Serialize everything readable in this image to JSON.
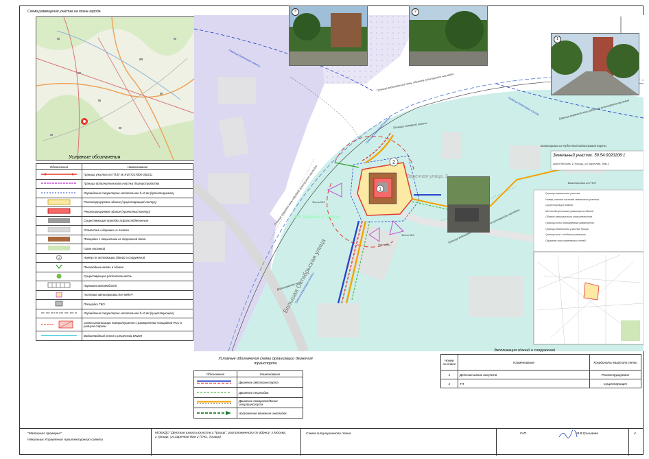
{
  "location_map": {
    "caption": "Схема размещения участка на плане города"
  },
  "legend": {
    "title": "Условные обозначения",
    "header_symbol": "Обозначения",
    "header_name": "Наименование",
    "items": [
      "Граница участка по ГПЗУ № RU77227000-030211",
      "Граница дополнительного участка благоустройства",
      "Ограждение территории капитальное h=2,4м (проектируемое)",
      "Реконструируемое здание (существующий контур)",
      "Реконструируемое здание (проектный контур)",
      "Существующие проезды асфальтобетонные",
      "Отмостка и дорожки из плитки",
      "Площадка с покрытием из террасной доски",
      "Газон посевной",
      "Номер по экспликации зданий и сооружений",
      "Пешеходные входы в здание",
      "Существующая растительность",
      "Парковка автомобилей",
      "Гостевая автопарковка для ММГН",
      "Площадка ТБО",
      "Ограждение территории капитальное h=2,4м (существующее)",
      "Схема организации пожаротушения с разворотной площадкой РСС в радиусе стрелы",
      "Водоотводный лоток с решеткой DN200"
    ]
  },
  "plan": {
    "north_symbol": "С",
    "labels": {
      "border_1": "Граница Береговой полосы",
      "border_2": "Граница Береговой полосы",
      "border_3": "Граница Береговой полосы",
      "border_4": "Граница Береговой полосы",
      "water_zone_1": "Граница водоохранной зоны объекта культурного наследия",
      "water_zone_2": "Граница охранной зоны объекта культурного наследия",
      "water_zone_3": "Граница охранной зоны объекта культурного наследия",
      "water_zone_4": "Граница водоохранной зоны объекта культурного наследия",
      "water_zone_5": "Водоохранная зона",
      "fire_border": "Граница пожарной охраны",
      "map_source": "Выкопировка из Публичной кадастровой Карты",
      "gpzu_excerpt": "Выкопировка из ГПЗУ",
      "cadastre": "Земельный участок: 50:54:0020206:1",
      "cadastre_address": "город Москва, г.Троицк, ул.Заречная, дом 2",
      "street_big": "Большая Октябрьская улица",
      "street_2": "Заречная улица, 2",
      "school": "ЗСК Заречная в Троицке",
      "photo_label_1": "Фото №1",
      "photo_label_2": "Фото №2",
      "photo_label_3": "Фото №3",
      "marker_1": "1",
      "marker_2": "2"
    },
    "excerpt_legend": [
      "Границы земельного участка",
      "Номер участка на плане земельного участка",
      "Существующие здания",
      "Места допустимого размещения зданий",
      "Объект капитального строительства",
      "Границы зоны планируемого размещения",
      "Границы земельного участка Троицк",
      "Границы зон с особыми условиями",
      "Охранная зона инженерных сетей"
    ]
  },
  "photos": [
    {
      "number": "3"
    },
    {
      "number": "2"
    },
    {
      "number": "1"
    }
  ],
  "transport_legend": {
    "title": "Условные обозначения схемы организации движения транспорта",
    "header_symbol": "Обозначения",
    "header_name": "Наименование",
    "items": [
      "Движение автотранспорта",
      "Движение пешеходов",
      "Движение пожарного/Линия спецтранспорта",
      "Направление движения инвалидов"
    ]
  },
  "explication": {
    "title": "Экспликация зданий и сооружений",
    "headers": [
      "Номер на плане",
      "Наименование",
      "Координаты квартала сетки"
    ],
    "rows": [
      [
        "1",
        "Детская школа искусств",
        "Реконструируемое"
      ],
      [
        "2",
        "ТП",
        "Существующее"
      ]
    ]
  },
  "title_block": {
    "approval": "\"Материал проверен\"",
    "department": "Начальник Управления Архитектурного совета",
    "project": "МОБУДО \"Детская школа искусств г.Троицк\", расположенного по адресу: г.Москва, г.Троицк, ул.Заречная дом 2 (ТАО, Троицк)",
    "sheet_title": "Схема ситуационного плана",
    "gap": "ГАП",
    "gap_name": "М.В.Гришаева",
    "sheet_num": "4"
  },
  "colors": {
    "park_purple": "#dcd8f2",
    "water_cyan": "#cdeee9",
    "road_gray": "#e2e2e2",
    "boundary_red": "#e23a2c",
    "transport_blue": "#2a46c9",
    "pedestrian_green": "#4db84d",
    "fire_orange": "#f3a300"
  }
}
